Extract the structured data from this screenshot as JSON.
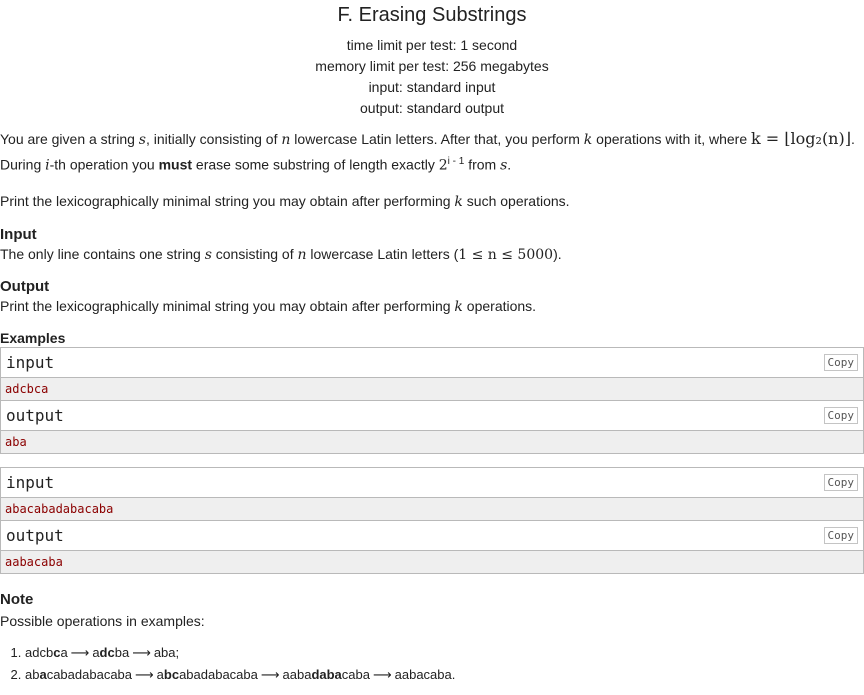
{
  "problem": {
    "title": "F. Erasing Substrings",
    "limits": [
      "time limit per test: 1 second",
      "memory limit per test: 256 megabytes",
      "input: standard input",
      "output: standard output"
    ]
  },
  "statement": {
    "line1_a": "You are given a string ",
    "var_s": "s",
    "line1_b": ", initially consisting of ",
    "var_n": "n",
    "line1_c": " lowercase Latin letters. After that, you perform ",
    "var_k": "k",
    "line1_d": " operations with it, where ",
    "formula_k": "k = ⌊log₂(n)⌋",
    "line1_e": ".",
    "line2_a": "During ",
    "var_i": "i",
    "line2_b": "-th operation you ",
    "must": "must",
    "line2_c": " erase some substring of length exactly ",
    "pow_base": "2",
    "pow_exp": "i - 1",
    "line2_d": " from ",
    "line2_e": ".",
    "line3_a": "Print the lexicographically minimal string you may obtain after performing ",
    "line3_b": " such operations."
  },
  "input_section": {
    "title": "Input",
    "text_a": "The only line contains one string ",
    "text_b": " consisting of ",
    "text_c": " lowercase Latin letters (",
    "constraint": "1 ≤ n ≤ 5000",
    "text_d": ")."
  },
  "output_section": {
    "title": "Output",
    "text_a": "Print the lexicographically minimal string you may obtain after performing ",
    "text_b": " operations."
  },
  "examples": {
    "title": "Examples",
    "copy_label": "Copy",
    "input_label": "input",
    "output_label": "output",
    "tests": [
      {
        "input": "adcbca",
        "output": "aba"
      },
      {
        "input": "abacabadabacaba",
        "output": "aabacaba"
      }
    ]
  },
  "note": {
    "title": "Note",
    "intro": "Possible operations in examples:",
    "arrow": "⟶",
    "item1": {
      "s1_a": "adcb",
      "s1_b": "c",
      "s1_c": "a",
      "s2_a": "a",
      "s2_b": "dc",
      "s2_c": "ba",
      "s3": "aba;"
    },
    "item2": {
      "s1_a": "ab",
      "s1_b": "a",
      "s1_c": "cabadabacaba",
      "s2_a": "a",
      "s2_b": "bc",
      "s2_c": "abadabacaba",
      "s3_a": "aaba",
      "s3_b": "daba",
      "s3_c": "caba",
      "s4": "aabacaba."
    }
  }
}
